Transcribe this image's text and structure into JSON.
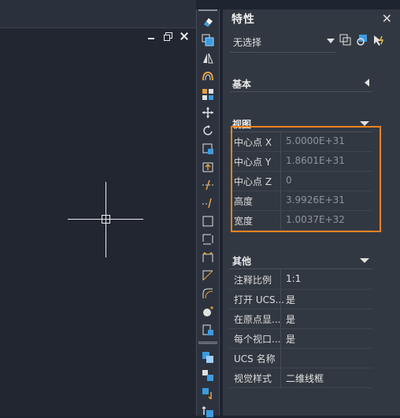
{
  "window_controls": {
    "minimize": "minimize",
    "restore": "restore",
    "close": "close"
  },
  "panel": {
    "title": "特性",
    "close_glyph": "✕",
    "selection": {
      "value": "无选择"
    },
    "sections": {
      "basic": {
        "label": "基本"
      },
      "view": {
        "label": "视图"
      },
      "other": {
        "label": "其他"
      }
    },
    "view_props": [
      {
        "key": "中心点 X",
        "value": "5.0000E+31"
      },
      {
        "key": "中心点 Y",
        "value": "1.8601E+31"
      },
      {
        "key": "中心点 Z",
        "value": "0"
      },
      {
        "key": "高度",
        "value": "3.9926E+31"
      },
      {
        "key": "宽度",
        "value": "1.0037E+32"
      }
    ],
    "other_props": [
      {
        "key": "注释比例",
        "value": "1:1"
      },
      {
        "key": "打开 UCS...",
        "value": "是"
      },
      {
        "key": "在原点显...",
        "value": "是"
      },
      {
        "key": "每个视口...",
        "value": "是"
      },
      {
        "key": "UCS 名称",
        "value": ""
      },
      {
        "key": "视觉样式",
        "value": "二维线框"
      }
    ]
  },
  "colors": {
    "highlight": "#f0821e",
    "accent_blue": "#3c9be0",
    "accent_orange": "#e8a23a"
  }
}
